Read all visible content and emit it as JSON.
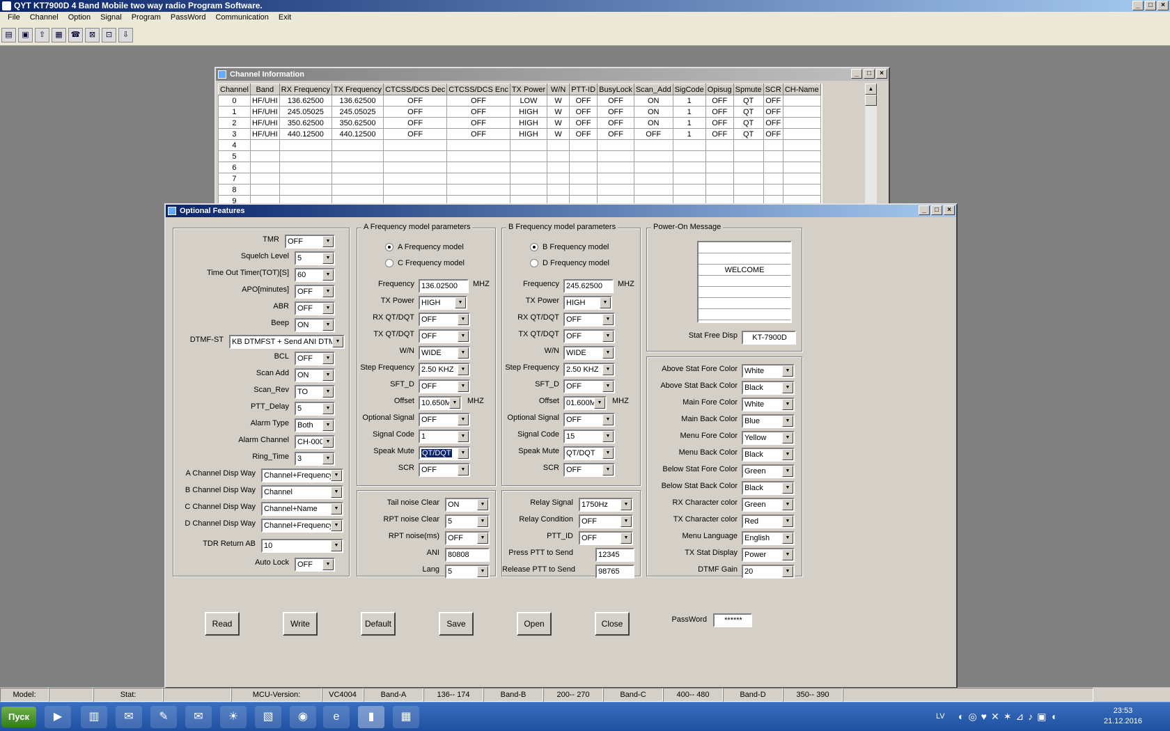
{
  "app_title": "QYT KT7900D 4 Band Mobile two way radio Program Software.",
  "menu": [
    "File",
    "Channel",
    "Option",
    "Signal",
    "Program",
    "PassWord",
    "Communication",
    "Exit"
  ],
  "channel_window": {
    "title": "Channel Information",
    "headers": [
      "Channel",
      "Band",
      "RX Frequency",
      "TX Frequency",
      "CTCSS/DCS Dec",
      "CTCSS/DCS Enc",
      "TX Power",
      "W/N",
      "PTT-ID",
      "BusyLock",
      "Scan_Add",
      "SigCode",
      "Opisug",
      "Spmute",
      "SCR",
      "CH-Name"
    ],
    "rows": [
      [
        "0",
        "HF/UHI",
        "136.62500",
        "136.62500",
        "OFF",
        "OFF",
        "LOW",
        "W",
        "OFF",
        "OFF",
        "ON",
        "1",
        "OFF",
        "QT",
        "OFF",
        ""
      ],
      [
        "1",
        "HF/UHI",
        "245.05025",
        "245.05025",
        "OFF",
        "OFF",
        "HIGH",
        "W",
        "OFF",
        "OFF",
        "ON",
        "1",
        "OFF",
        "QT",
        "OFF",
        ""
      ],
      [
        "2",
        "HF/UHI",
        "350.62500",
        "350.62500",
        "OFF",
        "OFF",
        "HIGH",
        "W",
        "OFF",
        "OFF",
        "ON",
        "1",
        "OFF",
        "QT",
        "OFF",
        ""
      ],
      [
        "3",
        "HF/UHI",
        "440.12500",
        "440.12500",
        "OFF",
        "OFF",
        "HIGH",
        "W",
        "OFF",
        "OFF",
        "OFF",
        "1",
        "OFF",
        "QT",
        "OFF",
        ""
      ],
      [
        "4",
        "",
        "",
        "",
        "",
        "",
        "",
        "",
        "",
        "",
        "",
        "",
        "",
        "",
        "",
        ""
      ],
      [
        "5",
        "",
        "",
        "",
        "",
        "",
        "",
        "",
        "",
        "",
        "",
        "",
        "",
        "",
        "",
        ""
      ],
      [
        "6",
        "",
        "",
        "",
        "",
        "",
        "",
        "",
        "",
        "",
        "",
        "",
        "",
        "",
        "",
        ""
      ],
      [
        "7",
        "",
        "",
        "",
        "",
        "",
        "",
        "",
        "",
        "",
        "",
        "",
        "",
        "",
        "",
        ""
      ],
      [
        "8",
        "",
        "",
        "",
        "",
        "",
        "",
        "",
        "",
        "",
        "",
        "",
        "",
        "",
        "",
        ""
      ],
      [
        "9",
        "",
        "",
        "",
        "",
        "",
        "",
        "",
        "",
        "",
        "",
        "",
        "",
        "",
        "",
        ""
      ]
    ]
  },
  "opt": {
    "title": "Optional Features",
    "left": [
      [
        "TMR",
        "OFF"
      ],
      [
        "Squelch Level",
        "5"
      ],
      [
        "Time Out Timer(TOT)[S]",
        "60"
      ],
      [
        "APO[minutes]",
        "OFF"
      ],
      [
        "ABR",
        "OFF"
      ],
      [
        "Beep",
        "ON"
      ],
      [
        "DTMF-ST",
        "KB DTMFST + Send ANI DTM"
      ],
      [
        "BCL",
        "OFF"
      ],
      [
        "Scan Add",
        "ON"
      ],
      [
        "Scan_Rev",
        "TO"
      ],
      [
        "PTT_Delay",
        "5"
      ],
      [
        "Alarm Type",
        "Both"
      ],
      [
        "Alarm Channel",
        "CH-000"
      ],
      [
        "Ring_Time",
        "3"
      ],
      [
        "A Channel Disp Way",
        "Channel+Frequency"
      ],
      [
        "B Channel Disp Way",
        "Channel"
      ],
      [
        "C Channel Disp Way",
        "Channel+Name"
      ],
      [
        "D Channel Disp Way",
        "Channel+Frequency"
      ],
      [
        "TDR Return AB",
        "10"
      ],
      [
        "Auto Lock",
        "OFF"
      ]
    ],
    "a": {
      "legend": "A Frequency model parameters",
      "r1": "A Frequency model",
      "r2": "C Frequency model",
      "freq_label": "Frequency",
      "freq": "136.02500",
      "unit": "MHZ",
      "fields": [
        [
          "TX Power",
          "HIGH"
        ],
        [
          "RX QT/DQT",
          "OFF"
        ],
        [
          "TX QT/DQT",
          "OFF"
        ],
        [
          "W/N",
          "WIDE"
        ],
        [
          "Step Frequency",
          "2.50 KHZ"
        ],
        [
          "SFT_D",
          "OFF"
        ],
        [
          "Offset",
          "10.650M"
        ],
        [
          "Optional Signal",
          "OFF"
        ],
        [
          "Signal Code",
          "1"
        ],
        [
          "Speak Mute",
          "QT/DQT"
        ],
        [
          "SCR",
          "OFF"
        ]
      ]
    },
    "b": {
      "legend": "B Frequency model parameters",
      "r1": "B Frequency model",
      "r2": "D Frequency model",
      "freq_label": "Frequency",
      "freq": "245.62500",
      "unit": "MHZ",
      "fields": [
        [
          "TX Power",
          "HIGH"
        ],
        [
          "RX QT/DQT",
          "OFF"
        ],
        [
          "TX QT/DQT",
          "OFF"
        ],
        [
          "W/N",
          "WIDE"
        ],
        [
          "Step Frequency",
          "2.50 KHZ"
        ],
        [
          "SFT_D",
          "OFF"
        ],
        [
          "Offset",
          "01.600M"
        ],
        [
          "Optional Signal",
          "OFF"
        ],
        [
          "Signal Code",
          "15"
        ],
        [
          "Speak Mute",
          "QT/DQT"
        ],
        [
          "SCR",
          "OFF"
        ]
      ]
    },
    "noise": [
      [
        "Tail noise Clear",
        "ON"
      ],
      [
        "RPT noise Clear",
        "5"
      ],
      [
        "RPT noise(ms)",
        "OFF"
      ],
      [
        "ANI",
        "80808"
      ],
      [
        "Lang",
        "5"
      ]
    ],
    "relay": [
      [
        "Relay Signal",
        "1750Hz"
      ],
      [
        "Relay Condition",
        "OFF"
      ],
      [
        "PTT_ID",
        "OFF"
      ],
      [
        "Press PTT to Send",
        "12345"
      ],
      [
        "Release PTT to Send",
        "98765"
      ]
    ],
    "poweron": {
      "legend": "Power-On Message",
      "lines": [
        "",
        "",
        "WELCOME",
        "",
        "",
        "",
        ""
      ],
      "stat_label": "Stat Free Disp",
      "stat": "KT-7900D"
    },
    "colors": [
      [
        "Above Stat Fore Color",
        "White"
      ],
      [
        "Above Stat Back Color",
        "Black"
      ],
      [
        "Main Fore Color",
        "White"
      ],
      [
        "Main Back Color",
        "Blue"
      ],
      [
        "Menu Fore Color",
        "Yellow"
      ],
      [
        "Menu Back Color",
        "Black"
      ],
      [
        "Below Stat Fore Color",
        "Green"
      ],
      [
        "Below Stat Back Color",
        "Black"
      ],
      [
        "RX Character color",
        "Green"
      ],
      [
        "TX Character color",
        "Red"
      ],
      [
        "Menu Language",
        "English"
      ],
      [
        "TX Stat Display",
        "Power"
      ],
      [
        "DTMF Gain",
        "20"
      ]
    ],
    "buttons": [
      "Read",
      "Write",
      "Default",
      "Save",
      "Open",
      "Close"
    ],
    "pw_label": "PassWord",
    "pw": "******"
  },
  "status": [
    "Model:",
    "",
    "Stat:",
    "",
    "MCU-Version:",
    "VC4004",
    "Band-A",
    "136-- 174",
    "Band-B",
    "200-- 270",
    "Band-C",
    "400-- 480",
    "Band-D",
    "350-- 390",
    ""
  ],
  "taskbar": {
    "start": "Пуск",
    "lang": "LV",
    "time": "23:53",
    "date": "21.12.2016"
  }
}
